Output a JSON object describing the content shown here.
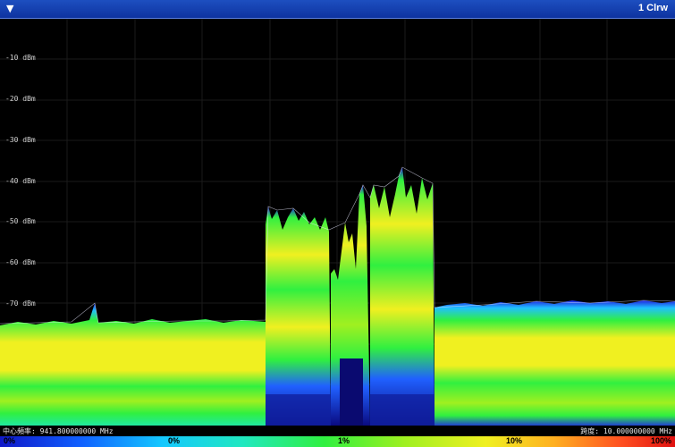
{
  "titlebar": {
    "menu_icon": "triangle-down-icon",
    "menu_glyph": "▼",
    "trace_label": "1 Clrw"
  },
  "y_axis_labels": [
    "-10 dBm",
    "-20 dBm",
    "-30 dBm",
    "-40 dBm",
    "-50 dBm",
    "-60 dBm",
    "-70 dBm"
  ],
  "footer": {
    "center_freq": "中心頻率: 941.800000000 MHz",
    "span": "跨度: 10.000000000 MHz"
  },
  "colorbar": {
    "ticks": [
      "0%",
      "0%",
      "1%",
      "10%",
      "100%"
    ]
  },
  "colors": {
    "accent": "#1d4fc0",
    "trace_low": "#1a2fd0",
    "trace_mid": "#30f040",
    "trace_high": "#f0f020"
  }
}
